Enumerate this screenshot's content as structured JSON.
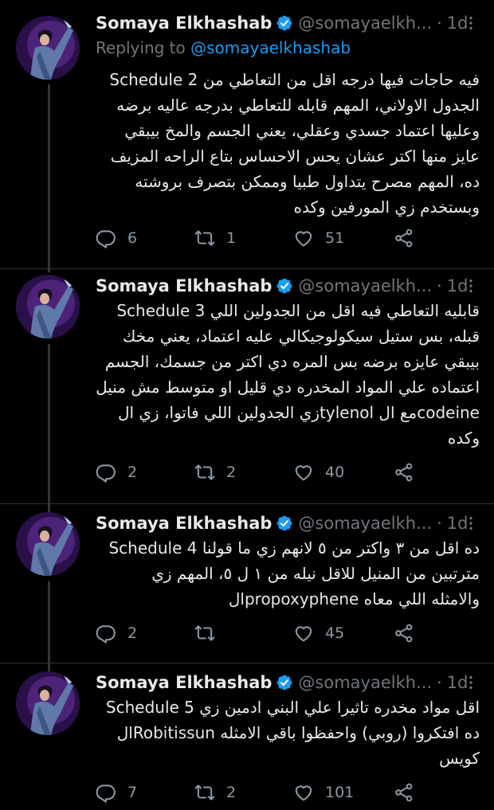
{
  "tweets": [
    {
      "author_name": "Somaya Elkhashab",
      "handle": "@somayaelkh...",
      "time": "1d",
      "replying_prefix": "Replying to ",
      "replying_handle": "@somayaelkhashab",
      "text": "Schedule 2 فيه حاجات فيها درجه اقل من التعاطي من الجدول الاولاني، المهم قابله للتعاطي بدرجه عاليه برضه وعليها اعتماد جسدي وعقلي، يعني الجسم والمخ بيبقي عايز منها اكتر عشان يحس الاحساس بتاع الراحه المزيف ده، المهم مصرح يتداول طبيا وممكن بتصرف بروشته وبستخدم زي المورفين وكده",
      "replies": "6",
      "retweets": "1",
      "likes": "51"
    },
    {
      "author_name": "Somaya Elkhashab",
      "handle": "@somayaelkh...",
      "time": "1d",
      "text": "Schedule 3 قابليه التعاطي فيه اقل من الجدولين اللي قبله، بس ستيل سيكولوجيكالي عليه اعتماد، يعني مخك بيبقي عايزه برضه بس المره دي اكتر من جسمك، الجسم اعتماده علي المواد المخدره دي قليل او متوسط مش منيل زي الجدولين اللي فاتوا، زي الtylenol مع الcodeine وكده",
      "replies": "2",
      "retweets": "2",
      "likes": "40"
    },
    {
      "author_name": "Somaya Elkhashab",
      "handle": "@somayaelkh...",
      "time": "1d",
      "text": "Schedule 4 ده اقل من ٣ واكتر من ٥ لانهم زي ما قولنا مترتبين من المنيل للاقل نيله من ١ ل ٥، المهم زي الpropoxyphene والامثله اللي معاه",
      "replies": "2",
      "retweets": "",
      "likes": "45"
    },
    {
      "author_name": "Somaya Elkhashab",
      "handle": "@somayaelkh...",
      "time": "1d",
      "text": "Schedule 5 اقل مواد مخدره تاثيرا علي البني ادمين زي الRobitissun ده افتكروا (روبي) واحفظوا باقي الامثله كويس",
      "replies": "7",
      "retweets": "2",
      "likes": "101"
    }
  ],
  "icons": {
    "verified": "verified-badge-icon",
    "more": "more-dots-icon",
    "reply": "reply-icon",
    "retweet": "retweet-icon",
    "like": "heart-icon",
    "share": "share-icon"
  },
  "colors": {
    "background": "#000000",
    "text": "#e7e9ea",
    "muted": "#71767b",
    "link": "#1d9bf0",
    "verified": "#1d9bf0",
    "divider": "#2f3336"
  }
}
